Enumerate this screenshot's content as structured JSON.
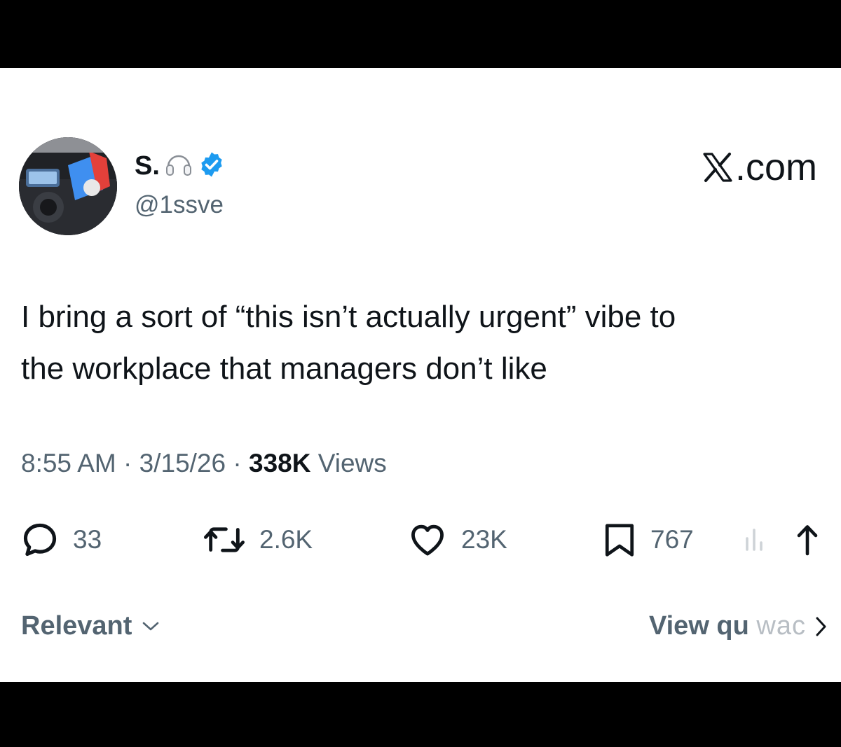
{
  "profile": {
    "display_name": "S.",
    "name_emoji_icon": "headphones-icon",
    "verified_icon": "verified-badge-icon",
    "handle": "@1ssve"
  },
  "brand": {
    "icon": "x-logo-icon",
    "suffix": ".com"
  },
  "tweet": {
    "line1": "I bring a sort of “this isn’t actually urgent” vibe to",
    "line2": "the workplace that managers don’t like"
  },
  "meta": {
    "time": "8:55 AM",
    "separator": "·",
    "date": "3/15/26",
    "views_count": "338K",
    "views_label": "Views"
  },
  "actions": {
    "replies": "33",
    "reposts": "2.6K",
    "likes": "23K",
    "bookmarks": "767"
  },
  "footer": {
    "sort_label": "Relevant",
    "quotes_label": "View qu",
    "quotes_label_faded": "wac"
  },
  "colors": {
    "text_primary": "#0f1419",
    "text_secondary": "#536471",
    "verified_blue": "#1d9bf0",
    "frame": "#000000"
  }
}
